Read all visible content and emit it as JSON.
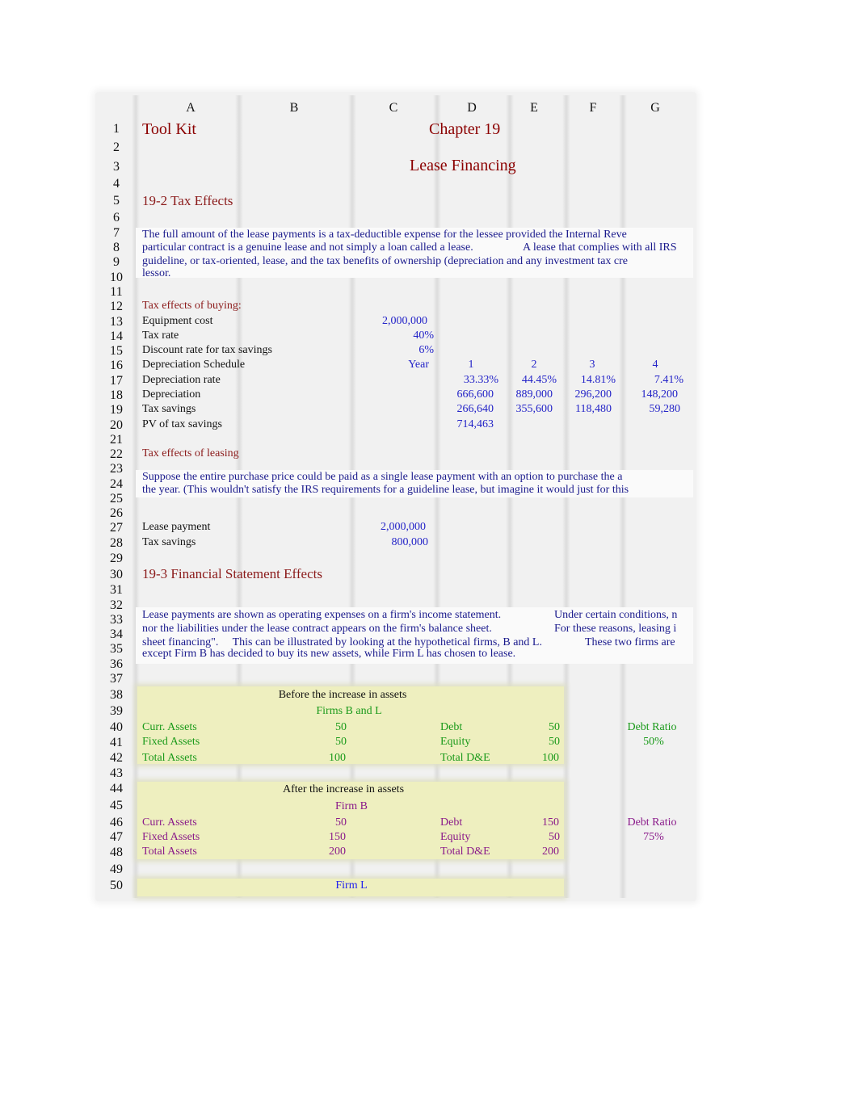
{
  "columns": [
    "A",
    "B",
    "C",
    "D",
    "E",
    "F",
    "G"
  ],
  "row_numbers": [
    "1",
    "2",
    "3",
    "4",
    "5",
    "6",
    "7",
    "8",
    "9",
    "10",
    "11",
    "12",
    "13",
    "14",
    "15",
    "16",
    "17",
    "18",
    "19",
    "20",
    "21",
    "22",
    "23",
    "24",
    "25",
    "26",
    "27",
    "28",
    "29",
    "30",
    "31",
    "32",
    "33",
    "34",
    "35",
    "36",
    "37",
    "38",
    "39",
    "40",
    "41",
    "42",
    "43",
    "44",
    "45",
    "46",
    "47",
    "48",
    "49",
    "50"
  ],
  "header": {
    "tool_kit": "Tool Kit",
    "chapter": "Chapter 19",
    "subtitle": "Lease Financing"
  },
  "section_tax": {
    "title": "19-2 Tax Effects",
    "paragraph": [
      "The full amount of the lease payments is a tax-deductible expense for the lessee provided the Internal Reve",
      "particular contract is a genuine lease and not simply a loan called a lease.",
      "A lease that complies with all IRS",
      "guideline, or tax-oriented, lease, and the tax benefits of ownership (depreciation and any investment tax cre",
      "lessor."
    ],
    "buying": {
      "title": "Tax effects of buying:",
      "equipment_cost_label": "Equipment cost",
      "equipment_cost": "2,000,000",
      "tax_rate_label": "Tax rate",
      "tax_rate": "40%",
      "discount_rate_label": "Discount rate for tax savings",
      "discount_rate": "6%",
      "schedule_label": "Depreciation Schedule",
      "year_label": "Year",
      "years": [
        "1",
        "2",
        "3",
        "4"
      ],
      "dep_rate_label": "Depreciation rate",
      "dep_rates": [
        "33.33%",
        "44.45%",
        "14.81%",
        "7.41%"
      ],
      "depreciation_label": "Depreciation",
      "depreciation": [
        "666,600",
        "889,000",
        "296,200",
        "148,200"
      ],
      "tax_savings_label": "Tax savings",
      "tax_savings": [
        "266,640",
        "355,600",
        "118,480",
        "59,280"
      ],
      "pv_label": "PV of tax savings",
      "pv": "714,463"
    },
    "leasing": {
      "title": "Tax effects of leasing",
      "paragraph": [
        "Suppose the entire purchase price could be paid as a single lease payment with an option to purchase the a",
        "the year. (This wouldn't satisfy the IRS requirements for a guideline lease, but imagine it would just for this"
      ],
      "lease_payment_label": "Lease payment",
      "lease_payment": "2,000,000",
      "tax_savings_label": "Tax savings",
      "tax_savings": "800,000"
    }
  },
  "section_fin": {
    "title": "19-3 Financial Statement Effects",
    "paragraph": [
      "Lease payments are shown as operating expenses on a firm's income statement.",
      "Under certain conditions, n",
      "nor the liabilities under the lease contract appears on the firm's balance sheet.",
      "For these reasons, leasing i",
      "sheet financing\".     This can be illustrated by looking at the hypothetical firms, B and L.",
      "These two firms are",
      "except Firm B has decided to buy its new assets, while Firm L has chosen to lease."
    ],
    "before": {
      "title": "Before the increase in assets",
      "firm": "Firms B and L",
      "curr_assets_label": "Curr. Assets",
      "curr_assets": "50",
      "fixed_assets_label": "Fixed Assets",
      "fixed_assets": "50",
      "total_assets_label": "Total Assets",
      "total_assets": "100",
      "debt_label": "Debt",
      "debt": "50",
      "equity_label": "Equity",
      "equity": "50",
      "total_de_label": "Total D&E",
      "total_de": "100",
      "debt_ratio_label": "Debt Ratio",
      "debt_ratio": "50%"
    },
    "after": {
      "title": "After the increase in assets",
      "firm": "Firm B",
      "curr_assets_label": "Curr. Assets",
      "curr_assets": "50",
      "fixed_assets_label": "Fixed Assets",
      "fixed_assets": "150",
      "total_assets_label": "Total Assets",
      "total_assets": "200",
      "debt_label": "Debt",
      "debt": "150",
      "equity_label": "Equity",
      "equity": "50",
      "total_de_label": "Total D&E",
      "total_de": "200",
      "debt_ratio_label": "Debt Ratio",
      "debt_ratio": "75%"
    },
    "firm_l": "Firm L"
  },
  "colors": {
    "title": "#8b0000",
    "input_blue": "#2424c8",
    "paragraph": "#1a1a8c",
    "firms_green": "#1a9a1a",
    "firm_b_purple": "#8a1a8a",
    "table_fill": "#eeefbf"
  }
}
